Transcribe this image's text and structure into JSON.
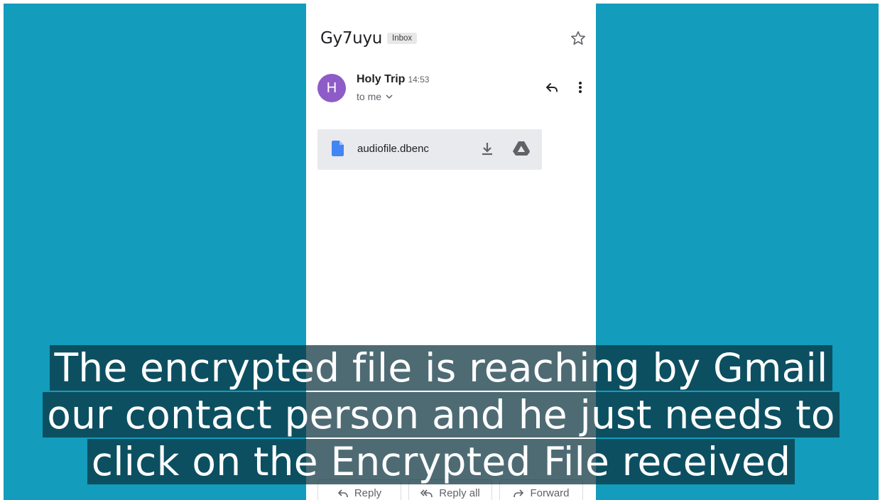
{
  "email": {
    "subject": "Gy7uyu",
    "label_badge": "Inbox",
    "sender_initial": "H",
    "sender_name": "Holy Trip",
    "time": "14:53",
    "recipient": "to me",
    "attachment": {
      "file_name": "audiofile.dbenc"
    },
    "actions": {
      "reply": "Reply",
      "reply_all": "Reply all",
      "forward": "Forward"
    }
  },
  "caption": {
    "line1": "The encrypted file is reaching by Gmail",
    "line2": "our contact person and he just needs to",
    "line3": "click on the Encrypted File received"
  },
  "colors": {
    "background": "#139cbc",
    "avatar": "#8e5cc7",
    "file_icon": "#4285f4",
    "caption_bg": "#0a323e"
  },
  "icons": {
    "star": "star-icon",
    "reply": "reply-icon",
    "more": "more-vert-icon",
    "file": "file-icon",
    "download": "download-icon",
    "drive": "drive-icon",
    "reply_all": "reply-all-icon",
    "forward": "forward-icon",
    "chevron": "chevron-down-icon"
  }
}
